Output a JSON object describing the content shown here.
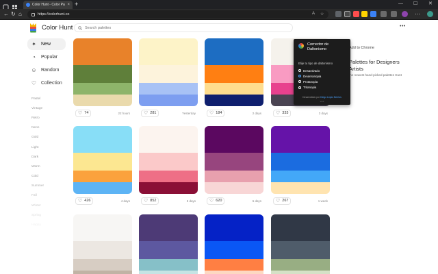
{
  "browser": {
    "tab_title": "Color Hunt - Color Palettes for Designers",
    "url": "https://colorhunt.co",
    "extension_colors": [
      "#5f6368",
      "#e8a23a",
      "#ff4d4d",
      "#ffd400",
      "#3b82f6",
      "#8e44ad"
    ]
  },
  "site": {
    "logo_text": "Color Hunt",
    "search_placeholder": "Search palettes",
    "more_dots": "•••"
  },
  "sidebar": {
    "items": [
      {
        "label": "New",
        "icon": "sparkle-icon",
        "glyph": "✦",
        "active": true
      },
      {
        "label": "Popular",
        "icon": "fire-icon",
        "glyph": "◔",
        "active": false
      },
      {
        "label": "Random",
        "icon": "random-icon",
        "glyph": "☺",
        "active": false
      },
      {
        "label": "Collection",
        "icon": "heart-icon",
        "glyph": "♡",
        "active": false
      }
    ],
    "tags": [
      "Pastel",
      "Vintage",
      "Retro",
      "Neon",
      "Gold",
      "Light",
      "Dark",
      "Warm",
      "Cold",
      "Summer",
      "Fall",
      "Winter",
      "Spring",
      "Happy"
    ]
  },
  "palettes": [
    {
      "colors": [
        "#e8822a",
        "#5f7f3a",
        "#8eb46a",
        "#eadaac"
      ],
      "likes": "74",
      "ago": "22 hours"
    },
    {
      "colors": [
        "#fdf3c8",
        "#fdf3dc",
        "#a8c2f5",
        "#7d9ef0"
      ],
      "likes": "281",
      "ago": "Yesterday"
    },
    {
      "colors": [
        "#1d6dc2",
        "#ff7f12",
        "#ffdd8e",
        "#0f1f6e"
      ],
      "likes": "184",
      "ago": "2 days"
    },
    {
      "colors": [
        "#f5f2ec",
        "#f99bc2",
        "#e8418e",
        "#4a4452"
      ],
      "likes": "333",
      "ago": "3 days"
    },
    {
      "colors": [
        "#88def7",
        "#fce791",
        "#fba23d",
        "#5db4f5"
      ],
      "likes": "426",
      "ago": "4 days"
    },
    {
      "colors": [
        "#fcf4ef",
        "#fbc9c9",
        "#ee6f86",
        "#8a0f36"
      ],
      "likes": "852",
      "ago": "5 days"
    },
    {
      "colors": [
        "#5b0860",
        "#97457e",
        "#e8a0ae",
        "#f8d6d6"
      ],
      "likes": "620",
      "ago": "6 days"
    },
    {
      "colors": [
        "#6513a8",
        "#1b6ce0",
        "#43a8f8",
        "#ffe4b0"
      ],
      "likes": "267",
      "ago": "1 week"
    },
    {
      "colors": [
        "#f7f6f4",
        "#ece7e2",
        "#d7cdc3",
        "#c1b3a5"
      ],
      "likes": "",
      "ago": ""
    },
    {
      "colors": [
        "#4d3a76",
        "#5d58a0",
        "#86c0c8",
        "#c5e4e4"
      ],
      "likes": "",
      "ago": ""
    },
    {
      "colors": [
        "#0522c6",
        "#0a57f5",
        "#ff7f43",
        "#fdd8c2"
      ],
      "likes": "",
      "ago": ""
    },
    {
      "colors": [
        "#303846",
        "#4f5c6a",
        "#98ae83",
        "#d5e1c6"
      ],
      "likes": "",
      "ago": ""
    }
  ],
  "promo": {
    "add_to_chrome": "Add to Chrome",
    "title": "Palettes for Designers Artists",
    "text": "the newest hand-picked palettes Hunt"
  },
  "popup": {
    "title": "Corrector de Daltonismo",
    "label": "Elije tu tipo de daltonismo",
    "options": [
      {
        "label": "Desactivado",
        "selected": false
      },
      {
        "label": "Deuteranopia",
        "selected": true
      },
      {
        "label": "Protanopia",
        "selected": false
      },
      {
        "label": "Tritanopia",
        "selected": false
      }
    ],
    "credit_prefix": "Desarrollado por",
    "credit_name": "Diego López Berrios",
    "version": "v1.0"
  }
}
